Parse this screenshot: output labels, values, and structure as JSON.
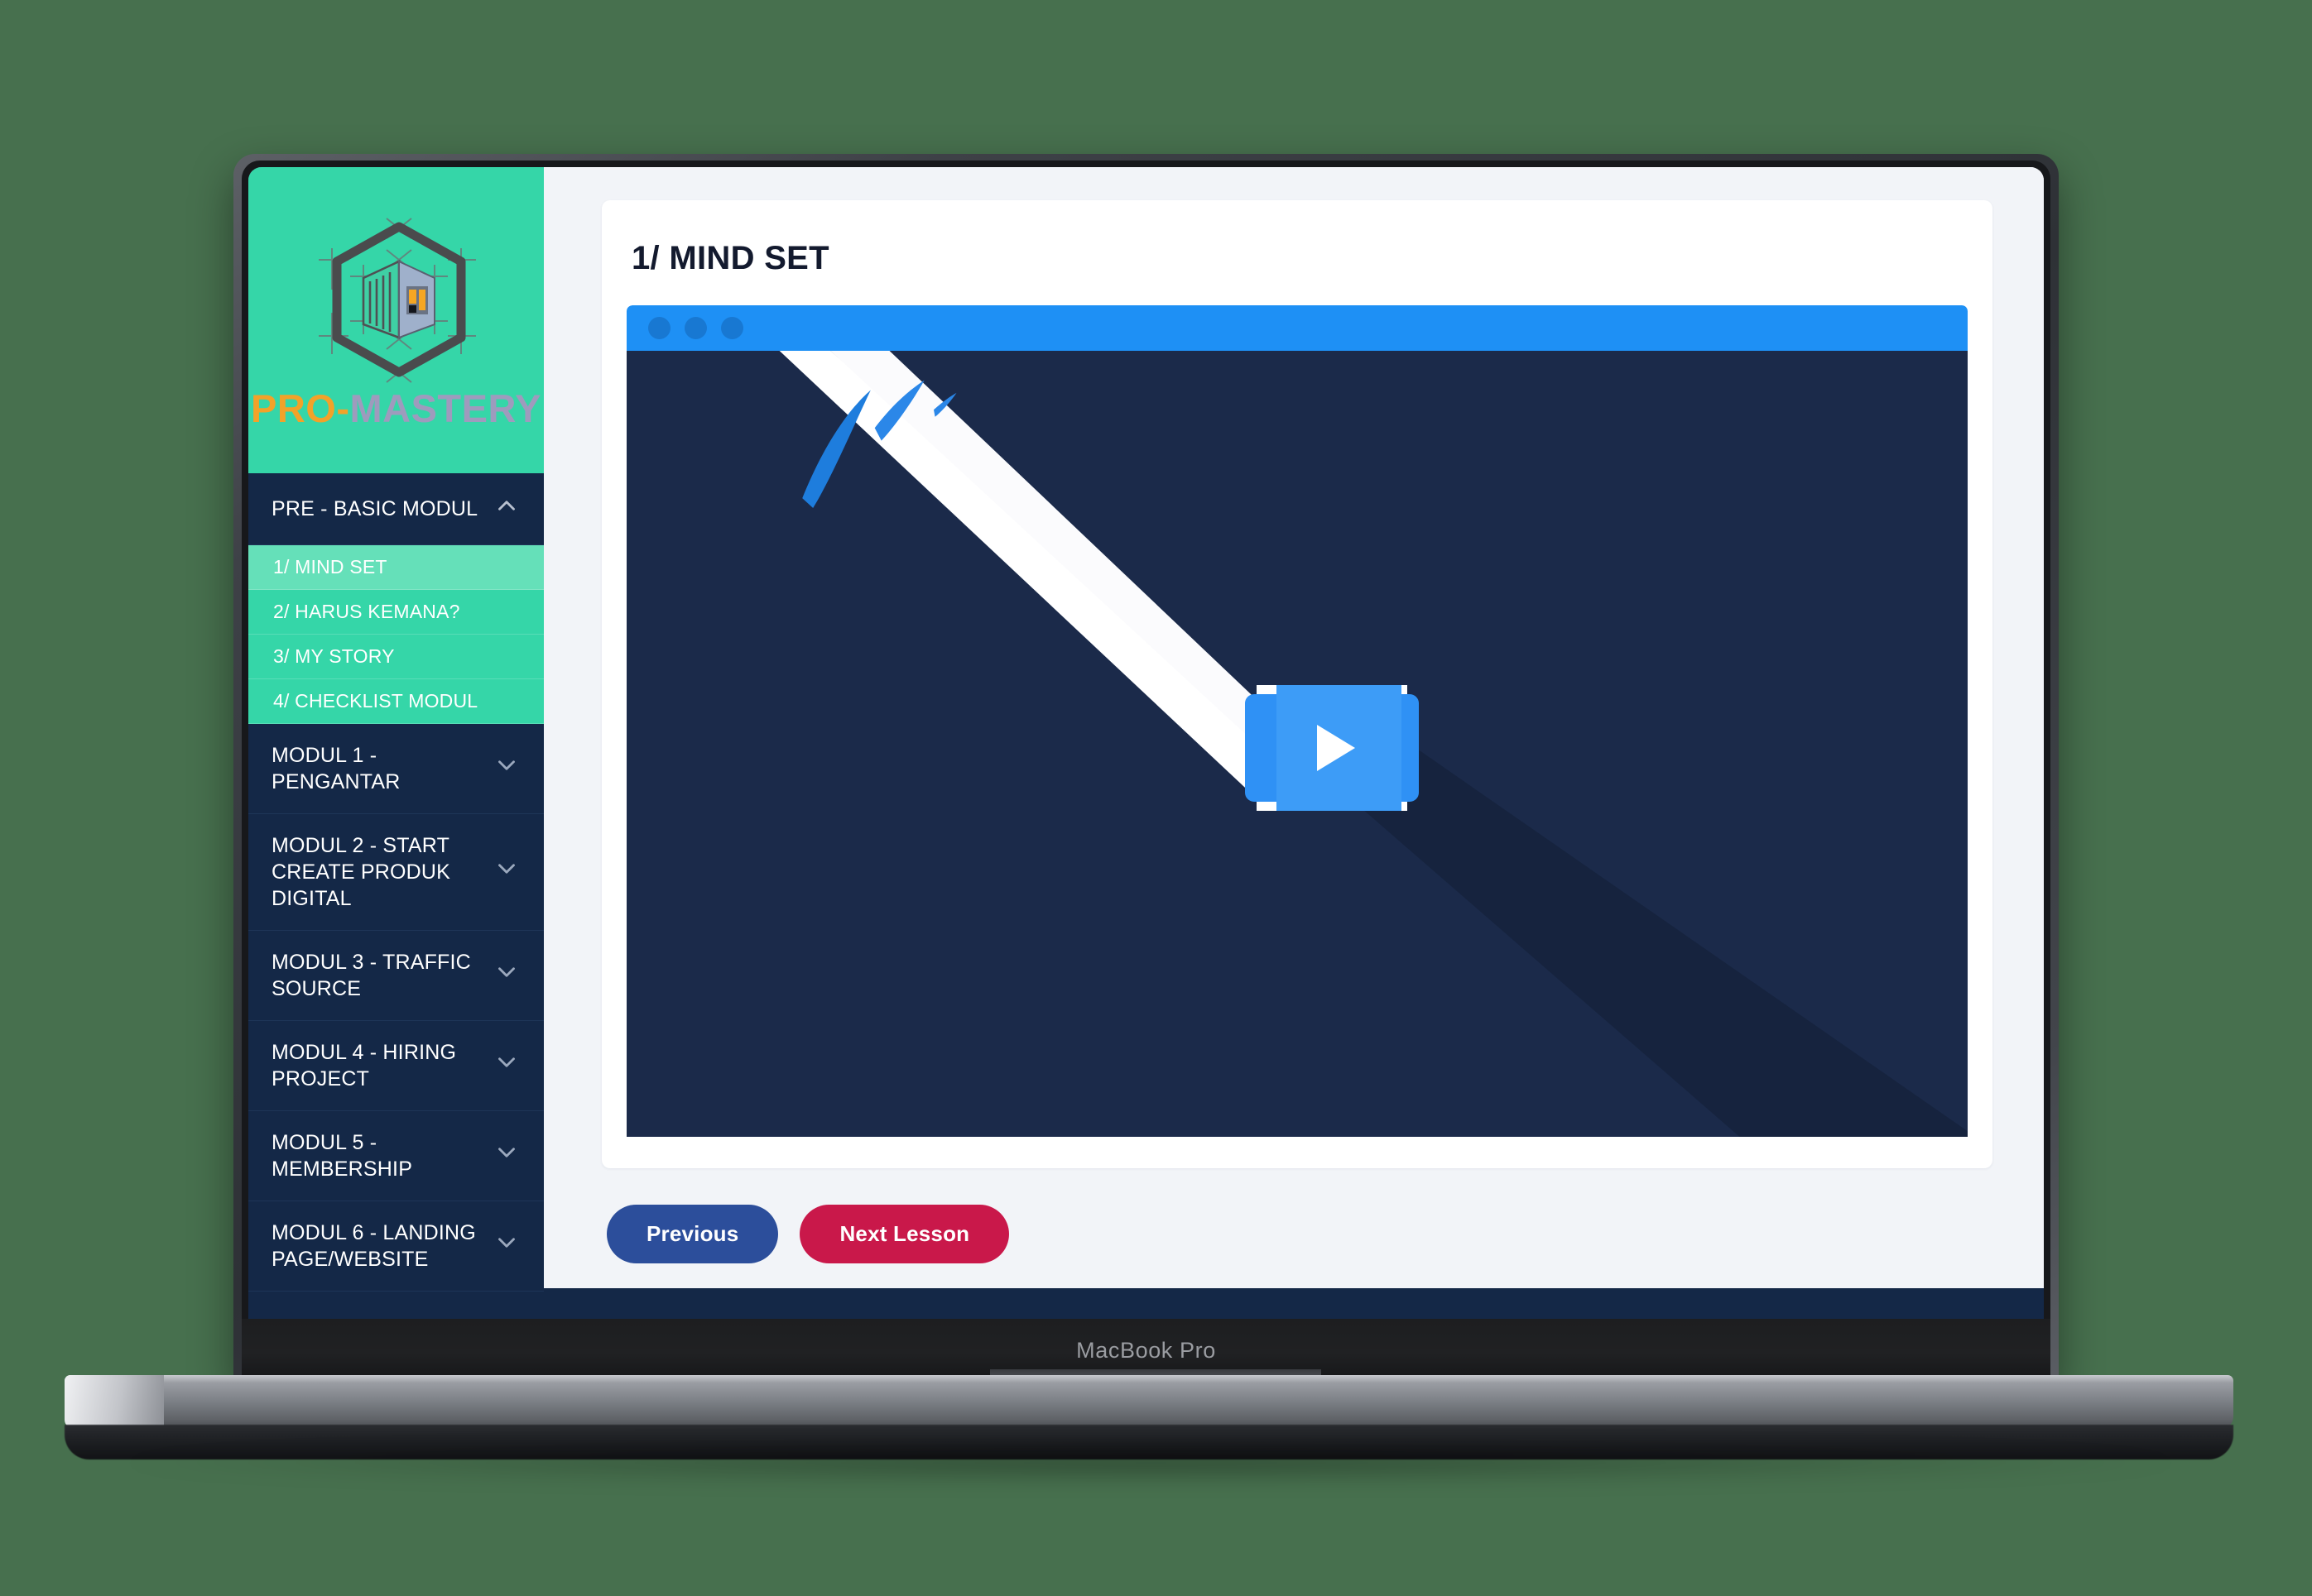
{
  "page": {
    "background_color": "#47704e"
  },
  "device": {
    "name": "MacBook Pro",
    "bezel_color": "#1d1e20"
  },
  "brand": {
    "logo_icon": "hexagon-container-logo",
    "text_pro": "PRO",
    "text_separator": "-",
    "text_mastery": "MASTERY",
    "pro_color": "#f2a229",
    "mastery_color": "#9e9bbd",
    "background_color": "#35d6a8"
  },
  "sidebar": {
    "background_color": "#142847",
    "accent_color": "#35d6a8",
    "active_color": "#65e0b9",
    "sections": [
      {
        "label": "PRE - BASIC MODUL",
        "expanded": true,
        "chevron": "chevron-up-icon",
        "lessons": [
          {
            "label": "1/ MIND SET",
            "active": true
          },
          {
            "label": "2/ HARUS KEMANA?",
            "active": false
          },
          {
            "label": "3/ MY STORY",
            "active": false
          },
          {
            "label": "4/ CHECKLIST MODUL",
            "active": false
          }
        ]
      },
      {
        "label": "MODUL 1 - PENGANTAR",
        "expanded": false,
        "chevron": "chevron-down-icon",
        "lessons": []
      },
      {
        "label": "MODUL 2 - START CREATE PRODUK DIGITAL",
        "expanded": false,
        "chevron": "chevron-down-icon",
        "lessons": []
      },
      {
        "label": "MODUL 3 - TRAFFIC SOURCE",
        "expanded": false,
        "chevron": "chevron-down-icon",
        "lessons": []
      },
      {
        "label": "MODUL 4 - HIRING PROJECT",
        "expanded": false,
        "chevron": "chevron-down-icon",
        "lessons": []
      },
      {
        "label": "MODUL 5 - MEMBERSHIP",
        "expanded": false,
        "chevron": "chevron-down-icon",
        "lessons": []
      },
      {
        "label": "MODUL 6 - LANDING PAGE/WEBSITE",
        "expanded": false,
        "chevron": "chevron-down-icon",
        "lessons": []
      }
    ]
  },
  "main": {
    "lesson_title": "1/ MIND SET",
    "video": {
      "titlebar_color": "#1e90f5",
      "stage_color": "#1b2a4a",
      "window_dots": 3,
      "play_button": "play-icon",
      "play_button_color": "#2f91f5"
    },
    "buttons": {
      "previous": "Previous",
      "previous_color": "#2c4e9b",
      "next": "Next Lesson",
      "next_color": "#c9184a"
    }
  }
}
